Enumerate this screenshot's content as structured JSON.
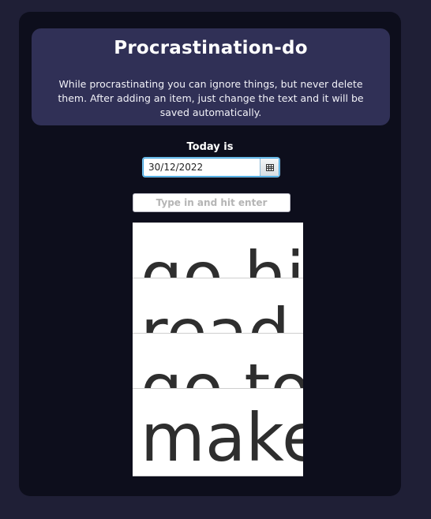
{
  "header": {
    "title": "Procrastination-do",
    "description": "While procrastinating you can ignore things, but never delete them. After adding an item, just change the text and it will be saved automatically."
  },
  "date": {
    "label": "Today is",
    "value": "30/12/2022",
    "calendar_icon": "calendar-icon"
  },
  "new_item": {
    "placeholder": "Type in and hit enter",
    "value": ""
  },
  "todos": [
    {
      "text": "go hi"
    },
    {
      "text": "read"
    },
    {
      "text": "go to"
    },
    {
      "text": "make"
    }
  ],
  "colors": {
    "page_background": "#1f1f36",
    "panel_background": "#0d0e1c",
    "header_background": "#303056",
    "focus_border": "#3aa1de"
  }
}
